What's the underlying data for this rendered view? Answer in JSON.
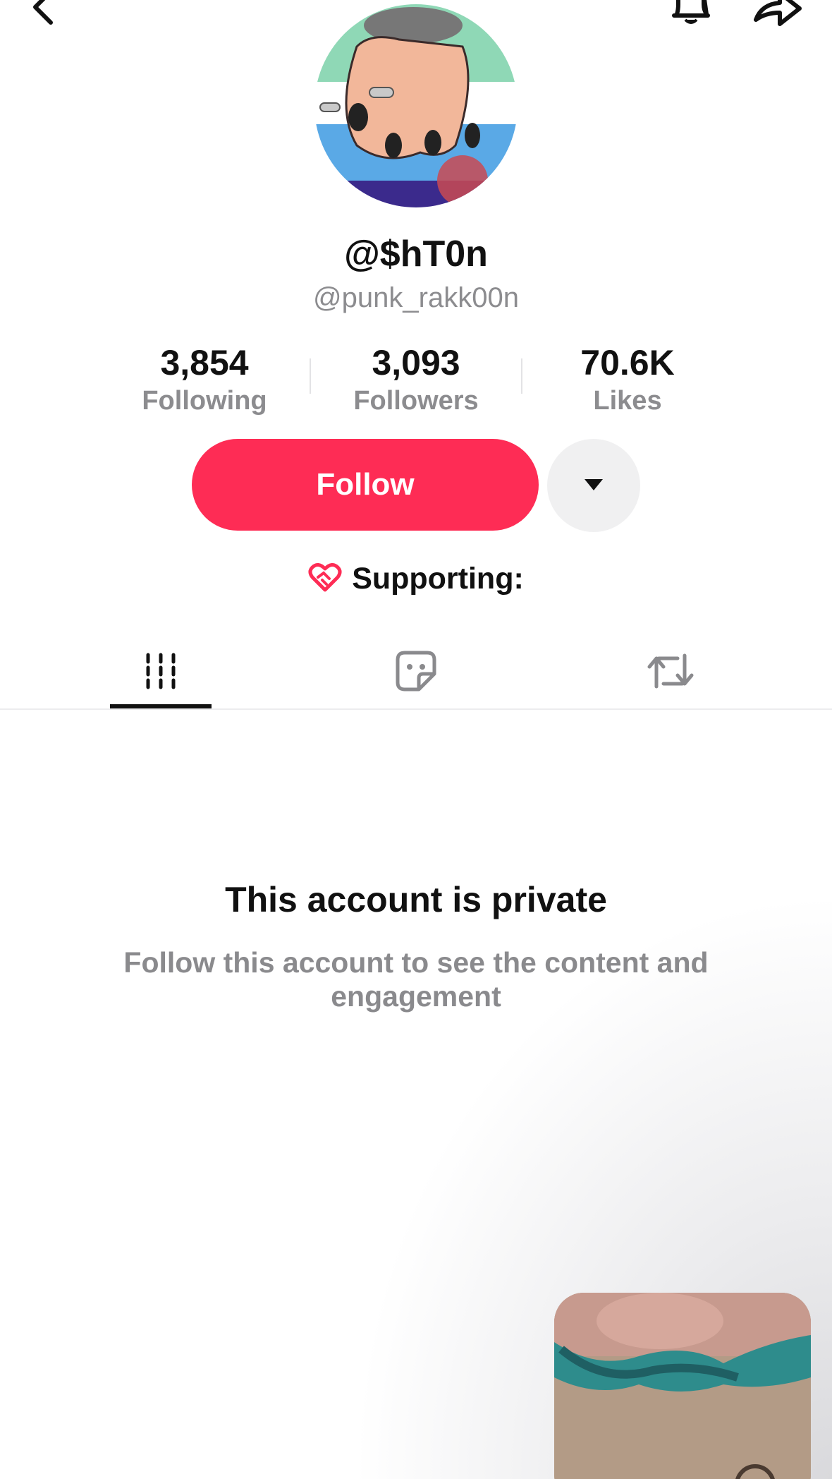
{
  "profile": {
    "display_name": "@$hT0n",
    "username": "@punk_rakk00n"
  },
  "stats": {
    "following": {
      "value": "3,854",
      "label": "Following"
    },
    "followers": {
      "value": "3,093",
      "label": "Followers"
    },
    "likes": {
      "value": "70.6K",
      "label": "Likes"
    }
  },
  "actions": {
    "follow_label": "Follow",
    "more_icon": "caret-down-icon"
  },
  "supporting": {
    "label": "Supporting:",
    "icon": "heart-handshake-icon"
  },
  "tabs": [
    {
      "name": "videos",
      "icon": "grid-icon",
      "active": true
    },
    {
      "name": "stickers",
      "icon": "sticker-icon",
      "active": false
    },
    {
      "name": "reposts",
      "icon": "repost-icon",
      "active": false
    }
  ],
  "private_notice": {
    "title": "This account is private",
    "description": "Follow this account to see the content and engagement"
  },
  "header_icons": [
    "back-arrow-icon",
    "bell-icon",
    "share-icon"
  ],
  "colors": {
    "accent": "#fe2c55",
    "secondary_text": "#8c8c8f",
    "primary_text": "#111111"
  }
}
